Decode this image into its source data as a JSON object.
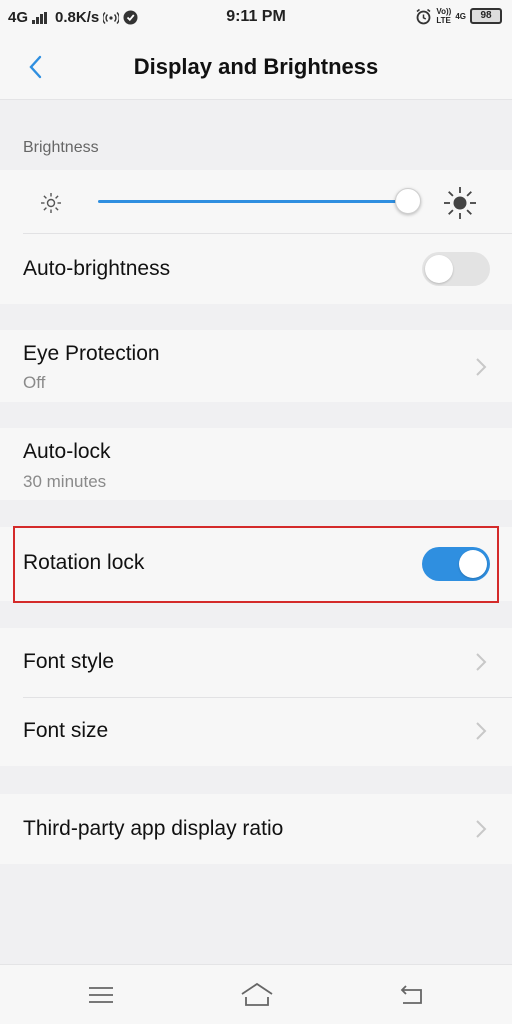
{
  "status_bar": {
    "network": "4G",
    "speed": "0.8K/s",
    "time": "9:11 PM",
    "volte_top": "Vo))",
    "volte_bottom": "LTE",
    "network2": "4G",
    "battery": "98"
  },
  "header": {
    "title": "Display and Brightness",
    "back_icon": "chevron-left-icon"
  },
  "brightness": {
    "section_label": "Brightness",
    "level_percent": 100,
    "min_icon": "sun-small-icon",
    "max_icon": "sun-large-icon"
  },
  "settings": {
    "auto_brightness": {
      "label": "Auto-brightness",
      "enabled": false
    },
    "eye_protection": {
      "label": "Eye Protection",
      "value": "Off"
    },
    "auto_lock": {
      "label": "Auto-lock",
      "value": "30 minutes"
    },
    "rotation_lock": {
      "label": "Rotation lock",
      "enabled": true
    },
    "font_style": {
      "label": "Font style"
    },
    "font_size": {
      "label": "Font size"
    },
    "third_party": {
      "label": "Third-party app display ratio"
    }
  },
  "nav_bar": {
    "menu_icon": "menu-icon",
    "home_icon": "home-icon",
    "back_icon": "back-icon"
  },
  "colors": {
    "accent": "#2f8fe0",
    "highlight": "#d42a2a",
    "background": "#f0f0f2",
    "card": "#f7f7f7"
  }
}
